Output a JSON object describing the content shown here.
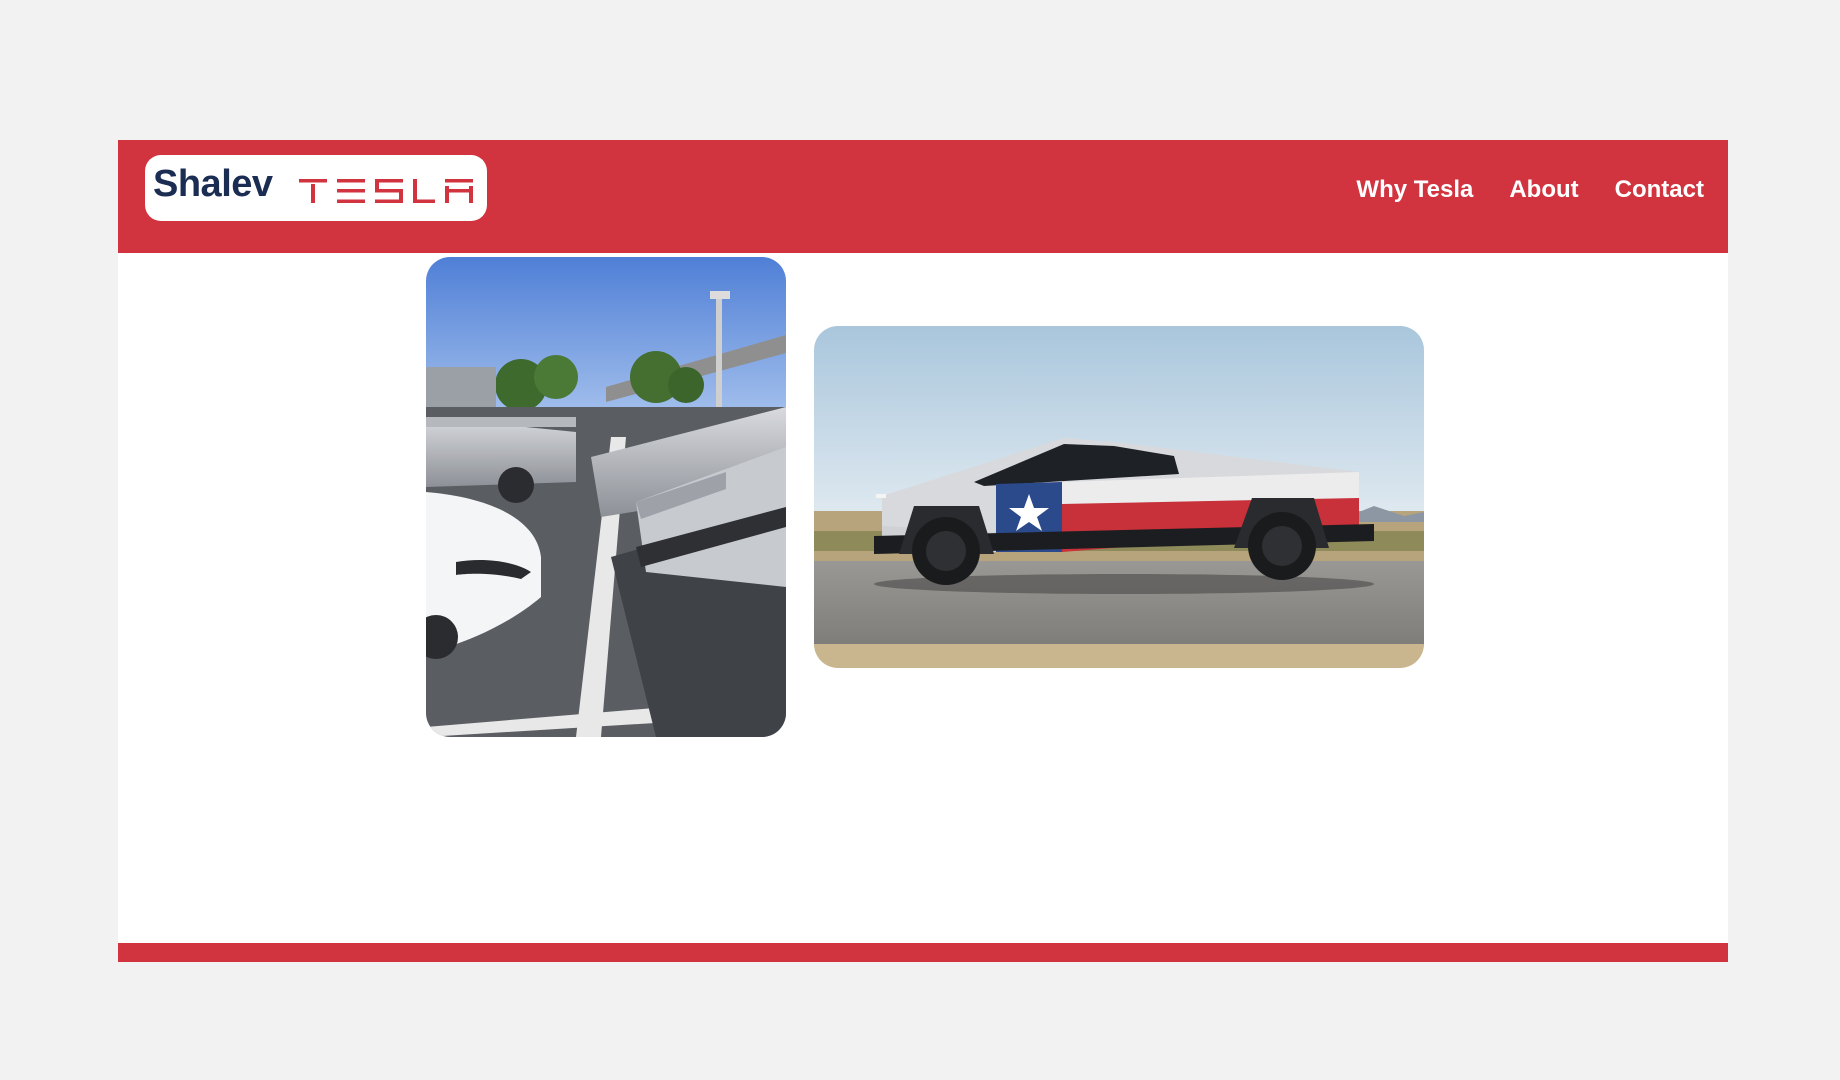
{
  "brand": {
    "name": "Shalev",
    "wordmark": "TESLA",
    "accent_color": "#d1333f",
    "name_color": "#1b2d52"
  },
  "nav": {
    "items": [
      {
        "label": "Why Tesla"
      },
      {
        "label": "About"
      },
      {
        "label": "Contact"
      }
    ]
  },
  "gallery": {
    "images": [
      {
        "name": "parking-lot-cybertrucks-photo"
      },
      {
        "name": "texas-flag-cybertruck-photo"
      }
    ]
  }
}
